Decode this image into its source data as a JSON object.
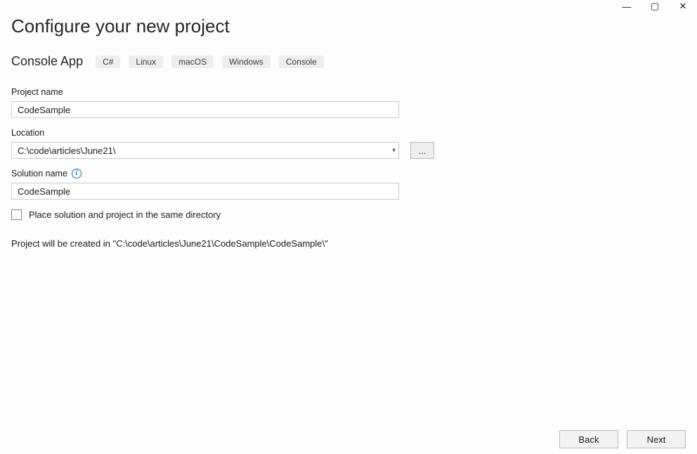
{
  "window": {
    "minimize": "—",
    "maximize": "▢",
    "close": "✕"
  },
  "header": {
    "title": "Configure your new project",
    "template_name": "Console App",
    "tags": [
      "C#",
      "Linux",
      "macOS",
      "Windows",
      "Console"
    ]
  },
  "fields": {
    "project_name": {
      "label": "Project name",
      "value": "CodeSample"
    },
    "location": {
      "label": "Location",
      "value": "C:\\code\\articles\\June21\\",
      "browse": "..."
    },
    "solution_name": {
      "label": "Solution name",
      "value": "CodeSample"
    },
    "same_dir": {
      "checked": false,
      "label": "Place solution and project in the same directory"
    }
  },
  "summary": "Project will be created in \"C:\\code\\articles\\June21\\CodeSample\\CodeSample\\\"",
  "footer": {
    "back": "Back",
    "next": "Next"
  }
}
